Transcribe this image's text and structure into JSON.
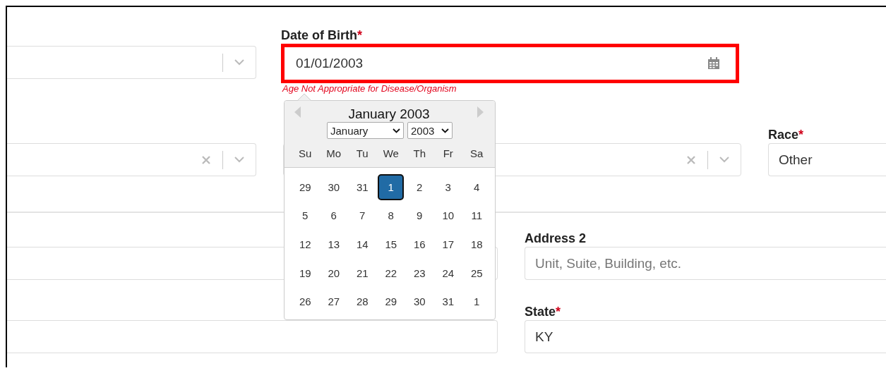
{
  "sections": [
    {
      "rows": [
        [
          {
            "kind": "select",
            "clearable": false
          },
          {
            "kind": "date",
            "label": "Date of Birth",
            "required_mark": "*",
            "value": "01/01/2003",
            "highlighted": true,
            "error": "Age Not Appropriate for Disease/Organism"
          }
        ],
        [
          {
            "kind": "select",
            "clearable": true
          },
          {
            "kind": "select",
            "clearable": true
          },
          {
            "kind": "text",
            "label": "Race",
            "required_mark": "*",
            "value": "Other"
          }
        ]
      ]
    },
    {
      "rows": [
        [
          {
            "kind": "text"
          },
          {
            "kind": "text",
            "label": "Address 2",
            "placeholder": "Unit, Suite, Building, etc."
          }
        ],
        [
          {
            "kind": "text"
          },
          {
            "kind": "text",
            "label": "State",
            "required_mark": "*",
            "value": "KY"
          }
        ]
      ]
    }
  ],
  "datepicker": {
    "title": "January 2003",
    "month": "January",
    "year": "2003",
    "weekdays": [
      "Su",
      "Mo",
      "Tu",
      "We",
      "Th",
      "Fr",
      "Sa"
    ],
    "weeks": [
      [
        {
          "day": "29",
          "selected": false
        },
        {
          "day": "30",
          "selected": false
        },
        {
          "day": "31",
          "selected": false
        },
        {
          "day": "1",
          "selected": true
        },
        {
          "day": "2",
          "selected": false
        },
        {
          "day": "3",
          "selected": false
        },
        {
          "day": "4",
          "selected": false
        }
      ],
      [
        {
          "day": "5",
          "selected": false
        },
        {
          "day": "6",
          "selected": false
        },
        {
          "day": "7",
          "selected": false
        },
        {
          "day": "8",
          "selected": false
        },
        {
          "day": "9",
          "selected": false
        },
        {
          "day": "10",
          "selected": false
        },
        {
          "day": "11",
          "selected": false
        }
      ],
      [
        {
          "day": "12",
          "selected": false
        },
        {
          "day": "13",
          "selected": false
        },
        {
          "day": "14",
          "selected": false
        },
        {
          "day": "15",
          "selected": false
        },
        {
          "day": "16",
          "selected": false
        },
        {
          "day": "17",
          "selected": false
        },
        {
          "day": "18",
          "selected": false
        }
      ],
      [
        {
          "day": "19",
          "selected": false
        },
        {
          "day": "20",
          "selected": false
        },
        {
          "day": "21",
          "selected": false
        },
        {
          "day": "22",
          "selected": false
        },
        {
          "day": "23",
          "selected": false
        },
        {
          "day": "24",
          "selected": false
        },
        {
          "day": "25",
          "selected": false
        }
      ],
      [
        {
          "day": "26",
          "selected": false
        },
        {
          "day": "27",
          "selected": false
        },
        {
          "day": "28",
          "selected": false
        },
        {
          "day": "29",
          "selected": false
        },
        {
          "day": "30",
          "selected": false
        },
        {
          "day": "31",
          "selected": false
        },
        {
          "day": "1",
          "selected": false
        }
      ]
    ]
  }
}
